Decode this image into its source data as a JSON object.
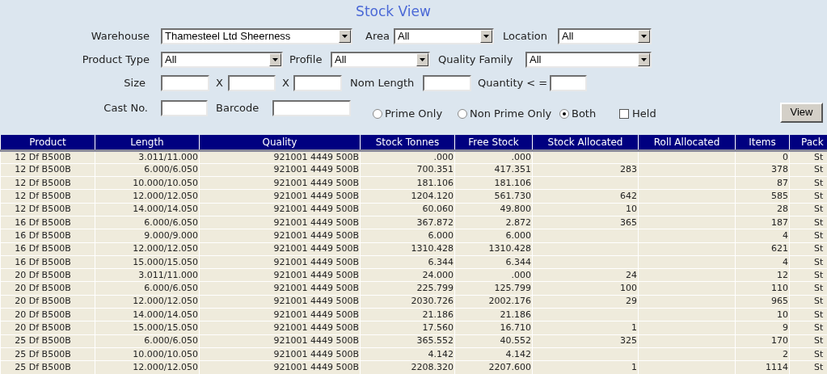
{
  "title": "Stock View",
  "form_rows": [
    [
      {
        "kind": "label",
        "text": "Warehouse"
      },
      {
        "kind": "select",
        "value": "Thamesteel Ltd Sheerness"
      },
      {
        "kind": "label",
        "text": "Area"
      },
      {
        "kind": "select",
        "value": "All"
      },
      {
        "kind": "label",
        "text": "Location"
      },
      {
        "kind": "select",
        "value": "All"
      }
    ],
    [
      {
        "kind": "label",
        "text": "Product Type"
      },
      {
        "kind": "select",
        "value": "All"
      },
      {
        "kind": "label",
        "text": "Profile"
      },
      {
        "kind": "select",
        "value": "All"
      },
      {
        "kind": "label",
        "text": "Quality Family"
      },
      {
        "kind": "select",
        "value": "All"
      }
    ],
    [
      {
        "kind": "label",
        "text": "Size"
      },
      {
        "kind": "input"
      },
      {
        "kind": "label",
        "text": "X"
      },
      {
        "kind": "input"
      },
      {
        "kind": "label",
        "text": "X"
      },
      {
        "kind": "input"
      },
      {
        "kind": "label",
        "text": "Nom Length"
      },
      {
        "kind": "input"
      },
      {
        "kind": "label",
        "text": "Quantity < ="
      },
      {
        "kind": "input"
      }
    ],
    [
      {
        "kind": "label",
        "text": "Cast No."
      },
      {
        "kind": "input"
      },
      {
        "kind": "label",
        "text": "Barcode"
      },
      {
        "kind": "input"
      },
      {
        "kind": "radio",
        "label": "Prime Only",
        "selected": false
      },
      {
        "kind": "radio",
        "label": "Non Prime Only",
        "selected": false
      },
      {
        "kind": "radio",
        "label": "Both",
        "selected": true
      },
      {
        "kind": "checkbox",
        "label": "Held",
        "checked": false
      },
      {
        "kind": "button",
        "label": "View"
      }
    ]
  ],
  "table": {
    "columns": [
      "Product",
      "Length",
      "Quality",
      "Stock Tonnes",
      "Free Stock",
      "Stock Allocated",
      "Roll Allocated",
      "Items",
      "Pack"
    ],
    "rows": [
      {
        "product": "12 Df B500B",
        "length": "3.011/11.000",
        "quality": "921001 4449 500B",
        "stock_tonnes": ".000",
        "free_stock": ".000",
        "items": "0",
        "pack": "St"
      },
      {
        "product": "12 Df B500B",
        "length": "6.000/6.050",
        "quality": "921001 4449 500B",
        "stock_tonnes": "700.351",
        "free_stock": "417.351",
        "stock_allocated": "283",
        "items": "378",
        "pack": "St"
      },
      {
        "product": "12 Df B500B",
        "length": "10.000/10.050",
        "quality": "921001 4449 500B",
        "stock_tonnes": "181.106",
        "free_stock": "181.106",
        "items": "87",
        "pack": "St"
      },
      {
        "product": "12 Df B500B",
        "length": "12.000/12.050",
        "quality": "921001 4449 500B",
        "stock_tonnes": "1204.120",
        "free_stock": "561.730",
        "stock_allocated": "642",
        "items": "585",
        "pack": "St"
      },
      {
        "product": "12 Df B500B",
        "length": "14.000/14.050",
        "quality": "921001 4449 500B",
        "stock_tonnes": "60.060",
        "free_stock": "49.800",
        "stock_allocated": "10",
        "items": "28",
        "pack": "St"
      },
      {
        "product": "16 Df B500B",
        "length": "6.000/6.050",
        "quality": "921001 4449 500B",
        "stock_tonnes": "367.872",
        "free_stock": "2.872",
        "stock_allocated": "365",
        "items": "187",
        "pack": "St"
      },
      {
        "product": "16 Df B500B",
        "length": "9.000/9.000",
        "quality": "921001 4449 500B",
        "stock_tonnes": "6.000",
        "free_stock": "6.000",
        "items": "4",
        "pack": "St"
      },
      {
        "product": "16 Df B500B",
        "length": "12.000/12.050",
        "quality": "921001 4449 500B",
        "stock_tonnes": "1310.428",
        "free_stock": "1310.428",
        "items": "621",
        "pack": "St"
      },
      {
        "product": "16 Df B500B",
        "length": "15.000/15.050",
        "quality": "921001 4449 500B",
        "stock_tonnes": "6.344",
        "free_stock": "6.344",
        "items": "4",
        "pack": "St"
      },
      {
        "product": "20 Df B500B",
        "length": "3.011/11.000",
        "quality": "921001 4449 500B",
        "stock_tonnes": "24.000",
        "free_stock": ".000",
        "stock_allocated": "24",
        "items": "12",
        "pack": "St"
      },
      {
        "product": "20 Df B500B",
        "length": "6.000/6.050",
        "quality": "921001 4449 500B",
        "stock_tonnes": "225.799",
        "free_stock": "125.799",
        "stock_allocated": "100",
        "items": "110",
        "pack": "St"
      },
      {
        "product": "20 Df B500B",
        "length": "12.000/12.050",
        "quality": "921001 4449 500B",
        "stock_tonnes": "2030.726",
        "free_stock": "2002.176",
        "stock_allocated": "29",
        "items": "965",
        "pack": "St"
      },
      {
        "product": "20 Df B500B",
        "length": "14.000/14.050",
        "quality": "921001 4449 500B",
        "stock_tonnes": "21.186",
        "free_stock": "21.186",
        "items": "10",
        "pack": "St"
      },
      {
        "product": "20 Df B500B",
        "length": "15.000/15.050",
        "quality": "921001 4449 500B",
        "stock_tonnes": "17.560",
        "free_stock": "16.710",
        "stock_allocated": "1",
        "items": "9",
        "pack": "St"
      },
      {
        "product": "25 Df B500B",
        "length": "6.000/6.050",
        "quality": "921001 4449 500B",
        "stock_tonnes": "365.552",
        "free_stock": "40.552",
        "stock_allocated": "325",
        "items": "170",
        "pack": "St"
      },
      {
        "product": "25 Df B500B",
        "length": "10.000/10.050",
        "quality": "921001 4449 500B",
        "stock_tonnes": "4.142",
        "free_stock": "4.142",
        "items": "2",
        "pack": "St"
      },
      {
        "product": "25 Df B500B",
        "length": "12.000/12.050",
        "quality": "921001 4449 500B",
        "stock_tonnes": "2208.320",
        "free_stock": "2207.600",
        "stock_allocated": "1",
        "items": "1114",
        "pack": "St"
      }
    ]
  }
}
